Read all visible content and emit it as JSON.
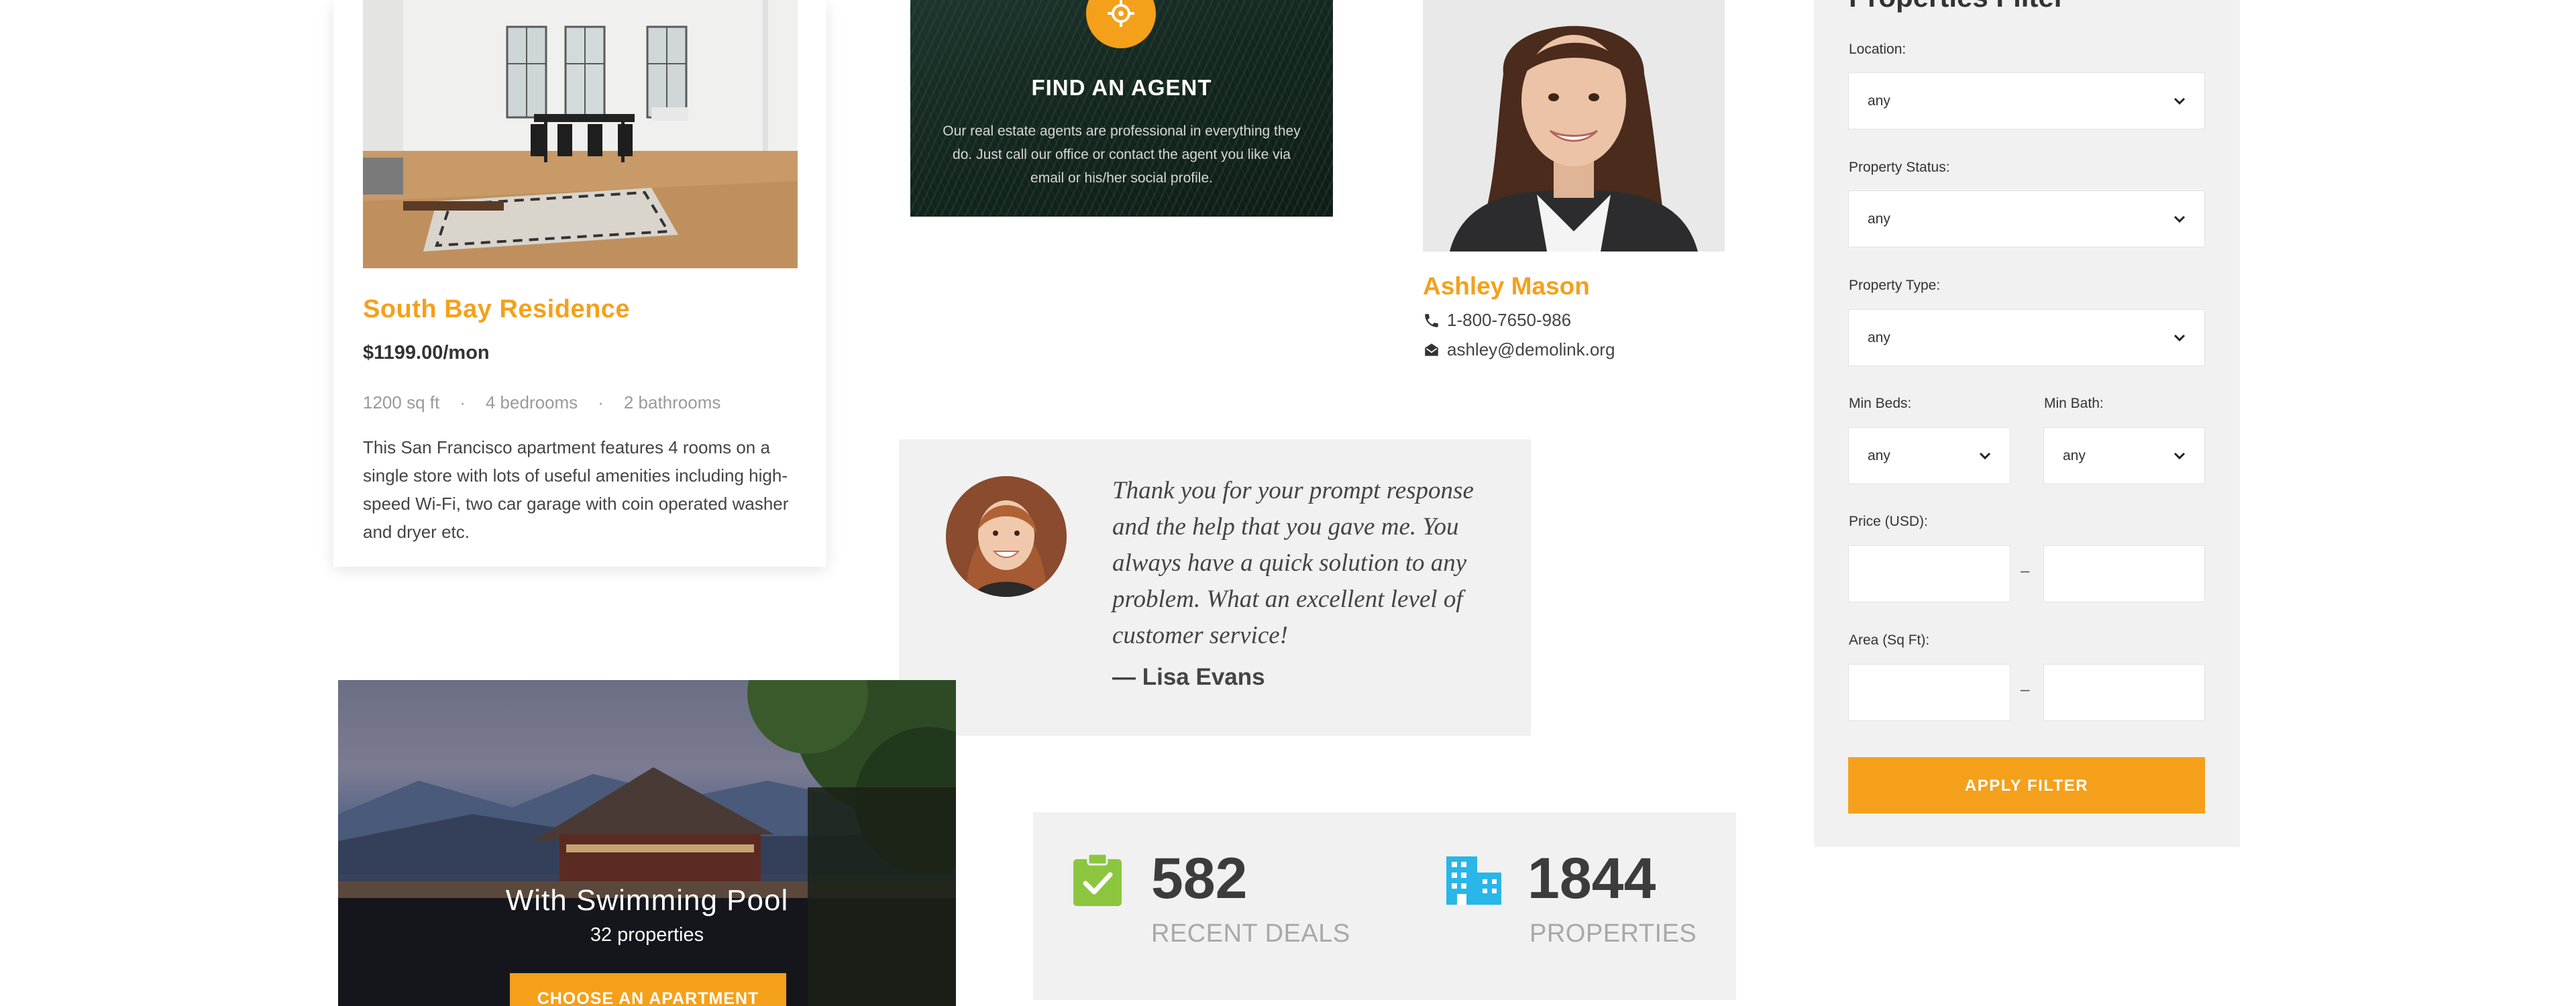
{
  "property_card": {
    "title": "South Bay Residence",
    "price": "$1199.00/mon",
    "area": "1200 sq ft",
    "bedrooms": "4 bedrooms",
    "bathrooms": "2 bathrooms",
    "separator": "·",
    "description": "This San Francisco apartment features 4 rooms on a single store with lots of useful amenities including high-speed Wi-Fi, two car garage with coin operated washer and dryer etc."
  },
  "agent_box": {
    "icon": "target-icon",
    "title": "FIND AN AGENT",
    "text": "Our real estate agents are professional in everything they do. Just call our office or contact the agent you like via email or his/her social profile."
  },
  "agent": {
    "name": "Ashley Mason",
    "phone": "1-800-7650-986",
    "email": "ashley@demolink.org"
  },
  "testimonial": {
    "quote": "Thank you for your prompt response and the help that you gave me. You always have a quick solution to any problem. What an excellent level of customer service!",
    "author": "— Lisa Evans"
  },
  "pool_banner": {
    "title": "With Swimming Pool",
    "count": "32 properties",
    "button": "CHOOSE AN APARTMENT"
  },
  "stats": [
    {
      "icon": "clipboard-check-icon",
      "value": "582",
      "label": "RECENT DEALS",
      "color": "#8cc63f"
    },
    {
      "icon": "buildings-icon",
      "value": "1844",
      "label": "PROPERTIES",
      "color": "#29b6e8"
    }
  ],
  "filter": {
    "title": "Properties Filter",
    "location_label": "Location:",
    "location_value": "any",
    "status_label": "Property Status:",
    "status_value": "any",
    "type_label": "Property Type:",
    "type_value": "any",
    "beds_label": "Min Beds:",
    "beds_value": "any",
    "bath_label": "Min Bath:",
    "bath_value": "any",
    "price_label": "Price (USD):",
    "area_label": "Area (Sq Ft):",
    "range_dash": "–",
    "apply_button": "APPLY FILTER"
  },
  "colors": {
    "accent": "#f5a01a",
    "panel_bg": "#f1f1f1",
    "deals_icon": "#8cc63f",
    "properties_icon": "#29b6e8"
  }
}
